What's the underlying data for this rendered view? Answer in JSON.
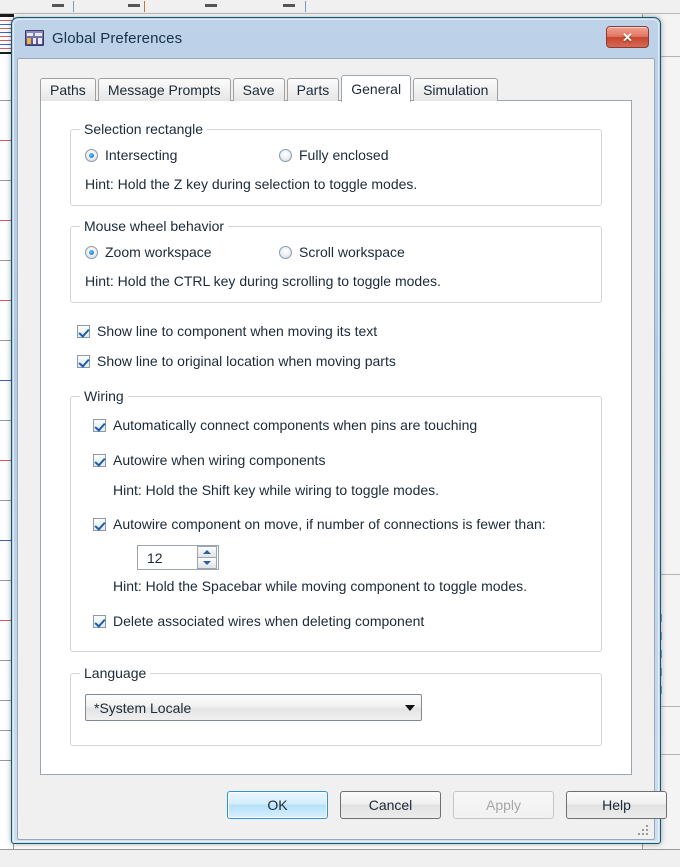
{
  "window": {
    "title": "Global Preferences",
    "icon": "preferences-icon",
    "close_label": "✕"
  },
  "tabs": [
    {
      "label": "Paths",
      "active": false
    },
    {
      "label": "Message Prompts",
      "active": false
    },
    {
      "label": "Save",
      "active": false
    },
    {
      "label": "Parts",
      "active": false
    },
    {
      "label": "General",
      "active": true
    },
    {
      "label": "Simulation",
      "active": false
    }
  ],
  "selection_rectangle": {
    "title": "Selection rectangle",
    "options": [
      {
        "label": "Intersecting",
        "checked": true
      },
      {
        "label": "Fully enclosed",
        "checked": false
      }
    ],
    "hint": "Hint: Hold the Z key during selection to toggle modes."
  },
  "mouse_wheel": {
    "title": "Mouse wheel behavior",
    "options": [
      {
        "label": "Zoom workspace",
        "checked": true
      },
      {
        "label": "Scroll workspace",
        "checked": false
      }
    ],
    "hint": "Hint: Hold the CTRL key during scrolling to toggle modes."
  },
  "standalone_checks": [
    {
      "label": "Show line to component when moving its text",
      "checked": true
    },
    {
      "label": "Show line to original location when moving parts",
      "checked": true
    }
  ],
  "wiring": {
    "title": "Wiring",
    "check_auto_connect": {
      "label": "Automatically connect components when pins are touching",
      "checked": true
    },
    "check_autowire": {
      "label": "Autowire when wiring components",
      "checked": true
    },
    "hint_shift": "Hint: Hold the Shift key while wiring to toggle modes.",
    "check_autowire_move": {
      "label": "Autowire component on move, if number of connections is fewer than:",
      "checked": true
    },
    "connections_value": "12",
    "hint_spacebar": "Hint: Hold the Spacebar while moving component to toggle modes.",
    "check_delete_wires": {
      "label": "Delete associated wires when deleting component",
      "checked": true
    }
  },
  "language": {
    "title": "Language",
    "selected": "*System Locale"
  },
  "buttons": {
    "ok": "OK",
    "cancel": "Cancel",
    "apply": "Apply",
    "help": "Help"
  },
  "colors": {
    "accent_blue": "#0a6bb5",
    "title_bar": "#b2cbe4",
    "close_red": "#c9452f",
    "dialog_bg": "#f0f0f0",
    "panel_bg": "#ffffff"
  }
}
